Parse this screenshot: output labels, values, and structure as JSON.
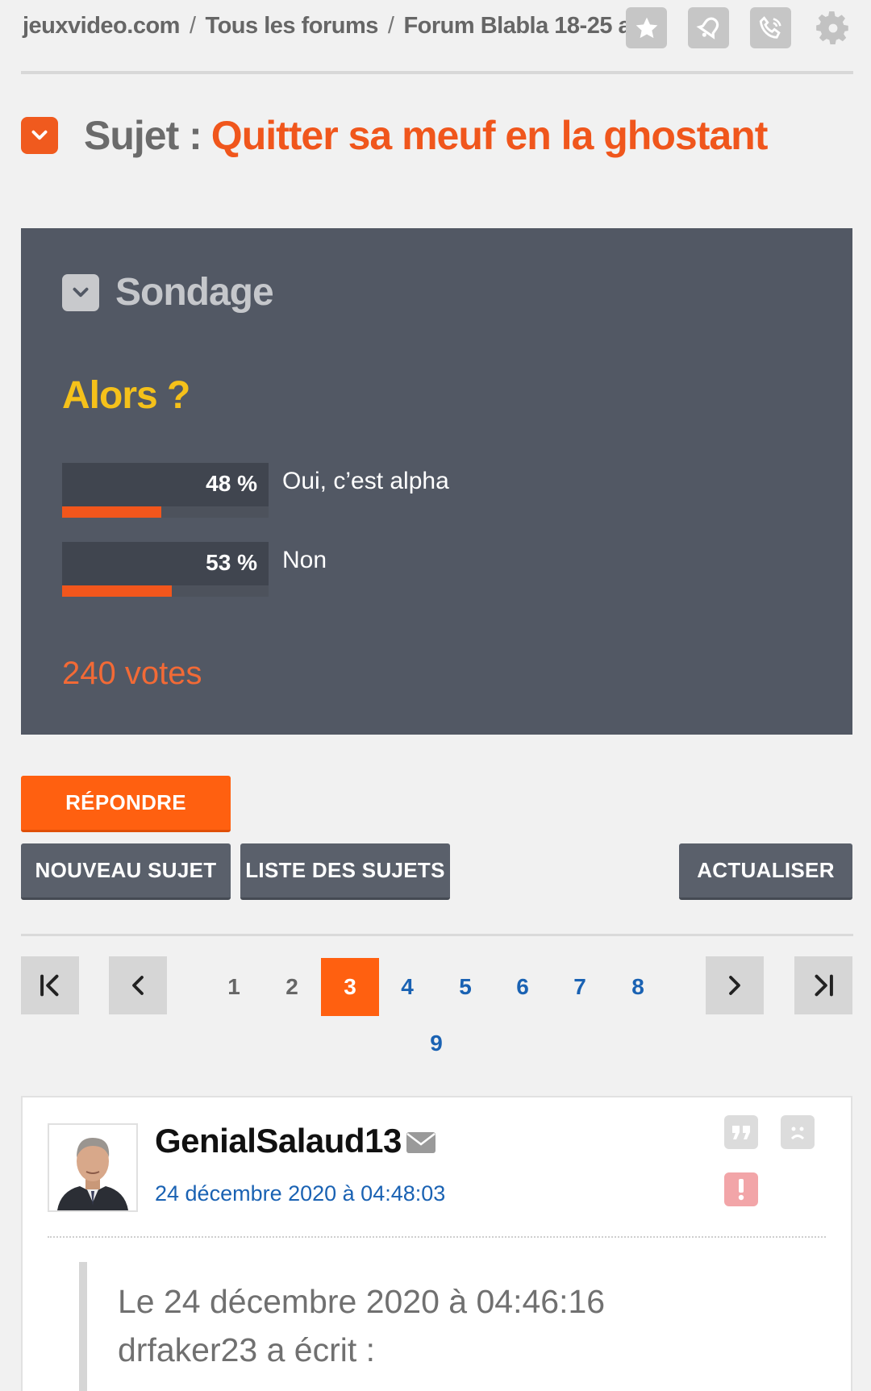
{
  "breadcrumb": {
    "items": [
      "jeuxvideo.com",
      "Tous les forums",
      "Forum Blabla 18-25 a..."
    ],
    "separator": "/"
  },
  "header_icons": [
    "star-icon",
    "bell-icon",
    "phone-icon",
    "gear-icon"
  ],
  "subject": {
    "label": "Sujet :",
    "title": "Quitter sa meuf en la ghostant"
  },
  "poll": {
    "heading": "Sondage",
    "question": "Alors ?",
    "answers": [
      {
        "percent_label": "48 %",
        "value": 0.48,
        "label": "Oui, c’est alpha"
      },
      {
        "percent_label": "53 %",
        "value": 0.53,
        "label": "Non"
      }
    ],
    "votes": "240 votes"
  },
  "buttons": {
    "reply": "RÉPONDRE",
    "new_topic": "NOUVEAU SUJET",
    "topic_list": "LISTE DES SUJETS",
    "refresh": "ACTUALISER"
  },
  "pagination": {
    "pages": [
      "1",
      "2",
      "3",
      "4",
      "5",
      "6",
      "7",
      "8",
      "9"
    ],
    "current": "3"
  },
  "post": {
    "author": "GenialSalaud13",
    "date": "24 décembre 2020 à 04:48:03",
    "quote_line1": "Le 24 décembre 2020 à 04:46:16",
    "quote_line2": "drfaker23 a écrit :"
  },
  "colors": {
    "accent": "#ff6010",
    "poll_bg": "#525864",
    "link": "#1a62b3",
    "question": "#f5c11a"
  }
}
